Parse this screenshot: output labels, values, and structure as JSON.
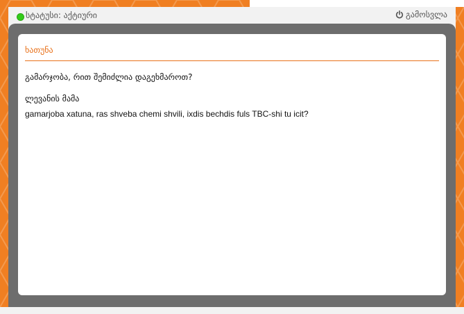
{
  "status": {
    "text": "სტატუსი: აქტიური",
    "indicator_color": "#33cc1a"
  },
  "header": {
    "logout_label": "გამოსვლა",
    "logout_icon": "power-icon"
  },
  "chat": {
    "title": "ხათუნა",
    "greeting": "გამარჯობა, რით შემიძლია დაგეხმაროთ?",
    "messages": [
      {
        "author": "ლევანის მამა",
        "text": "gamarjoba xatuna, ras shveba chemi shvili, ixdis bechdis fuls TBC-shi tu icit?"
      }
    ]
  },
  "colors": {
    "background_orange": "#f07f22",
    "accent": "#e8711a",
    "frame_gray": "#6d6d6d",
    "status_bar": "#f2f2f2"
  }
}
